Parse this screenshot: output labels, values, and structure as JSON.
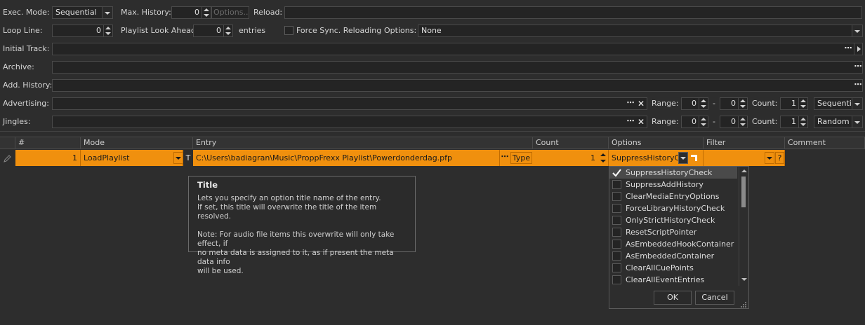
{
  "exec_mode": {
    "label": "Exec. Mode:",
    "value": "Sequential"
  },
  "max_history": {
    "label": "Max. History:",
    "value": "0",
    "options_button": "Options..."
  },
  "reload": {
    "label": "Reload:",
    "value": ""
  },
  "loop_line": {
    "label": "Loop Line:",
    "value": "0"
  },
  "playlist_look_ahead": {
    "label": "Playlist Look Ahead:",
    "value": "0",
    "suffix": "entries"
  },
  "force_sync_reloading": {
    "label": "Force Sync. Reloading",
    "checked": false
  },
  "options": {
    "label": "Options:",
    "value": "None"
  },
  "initial_track": {
    "label": "Initial Track:",
    "value": ""
  },
  "archive": {
    "label": "Archive:",
    "value": ""
  },
  "add_history": {
    "label": "Add. History:",
    "value": ""
  },
  "advertising": {
    "label": "Advertising:",
    "value": "",
    "range_label": "Range:",
    "range_from": "0",
    "range_to": "0",
    "range_sep": "-",
    "count_label": "Count:",
    "count": "1",
    "mode": "Sequential"
  },
  "jingles": {
    "label": "Jingles:",
    "value": "",
    "range_label": "Range:",
    "range_from": "0",
    "range_to": "0",
    "range_sep": "-",
    "count_label": "Count:",
    "count": "1",
    "mode": "Random"
  },
  "grid": {
    "columns": [
      "#",
      "Mode",
      "Entry",
      "Count",
      "Options",
      "Filter",
      "Comment"
    ],
    "row": {
      "index": "1",
      "mode": "LoadPlaylist",
      "t_flag": "T",
      "entry": "C:\\Users\\badiagran\\Music\\ProppFrexx Playlist\\Powerdonderdag.pfp",
      "type_button": "Type",
      "count": "1",
      "options": "SuppressHistoryC...",
      "filter_help": "?"
    }
  },
  "tooltip": {
    "title": "Title",
    "text": "Lets you specify an option title name of the entry.\nIf set, this title will overwrite the title of the item resolved.\n\nNote: For audio file items this overwrite will only take effect, if\nno meta data is assigned to it, as if present the meta data info\nwill be used."
  },
  "options_dropdown": {
    "items": [
      {
        "label": "SuppressHistoryCheck",
        "checked": true
      },
      {
        "label": "SuppressAddHistory",
        "checked": false
      },
      {
        "label": "ClearMediaEntryOptions",
        "checked": false
      },
      {
        "label": "ForceLibraryHistoryCheck",
        "checked": false
      },
      {
        "label": "OnlyStrictHistoryCheck",
        "checked": false
      },
      {
        "label": "ResetScriptPointer",
        "checked": false
      },
      {
        "label": "AsEmbeddedHookContainer",
        "checked": false
      },
      {
        "label": "AsEmbeddedContainer",
        "checked": false
      },
      {
        "label": "ClearAllCuePoints",
        "checked": false
      },
      {
        "label": "ClearAllEventEntries",
        "checked": false
      }
    ],
    "ok_label": "OK",
    "cancel_label": "Cancel"
  },
  "colors": {
    "accent": "#f0900e",
    "background": "#2d2d2d",
    "field": "#242424"
  }
}
